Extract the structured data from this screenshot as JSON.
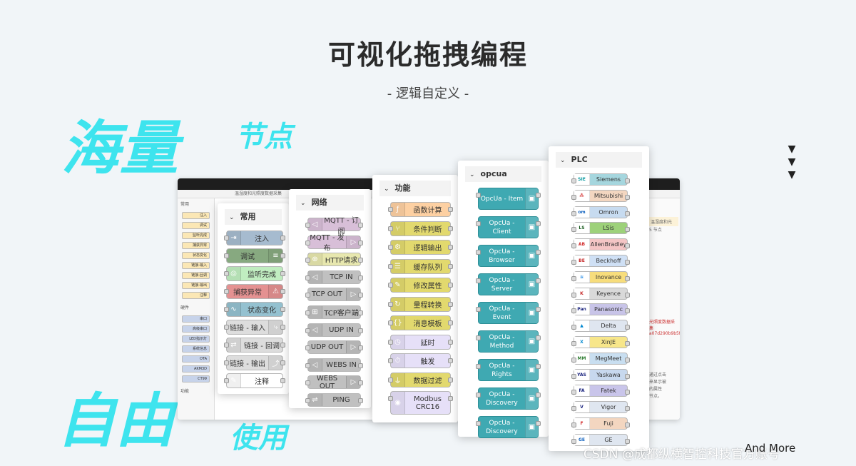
{
  "header": {
    "title": "可视化拖拽编程",
    "subtitle": "-  逻辑自定义  -"
  },
  "slogans": {
    "big1": "海量",
    "small1": "节点",
    "big2": "自由",
    "small2": "使用"
  },
  "arrows": [
    "▼",
    "▼",
    "▼"
  ],
  "window": {
    "tab": "温湿度和光照度数据采集",
    "categories": [
      "常用",
      "硬件",
      "功能"
    ],
    "mini_nodes": [
      "注入",
      "调试",
      "监听完成",
      "捕获异常",
      "状态变化",
      "链接-输入",
      "链接-回调",
      "链接-输出",
      "注释",
      "串口",
      "高级串口",
      "LED指示灯",
      "系统信息",
      "OTA",
      "AKM3D",
      "CT99"
    ],
    "right_text": [
      "温湿度和光",
      "5 节点",
      "光照度数据采集",
      "a07d290b9b5f90ca9",
      "通过点击",
      "来显示被",
      "的属性",
      "节点。"
    ]
  },
  "panels": {
    "common": {
      "title": "常用",
      "nodes": [
        {
          "label": "注入",
          "icon": "inject-icon",
          "glyph": "⇥",
          "color": "#a6bbcf"
        },
        {
          "label": "调试",
          "icon": "debug-icon",
          "glyph": "≡",
          "color": "#87a980"
        },
        {
          "label": "监听完成",
          "icon": "complete-icon",
          "glyph": "◎",
          "color": "#c0edc0"
        },
        {
          "label": "捕获异常",
          "icon": "catch-icon",
          "glyph": "⚠",
          "color": "#e49191"
        },
        {
          "label": "状态变化",
          "icon": "status-icon",
          "glyph": "∿",
          "color": "#94c1d0"
        },
        {
          "label": "链接 - 输入",
          "icon": "link-in-icon",
          "glyph": "⤷",
          "color": "#dddddd"
        },
        {
          "label": "链接 - 回调",
          "icon": "link-call-icon",
          "glyph": "⇄",
          "color": "#dddddd"
        },
        {
          "label": "链接 - 输出",
          "icon": "link-out-icon",
          "glyph": "⤴",
          "color": "#dddddd"
        },
        {
          "label": "注释",
          "icon": "comment-icon",
          "glyph": "✎",
          "color": "#ffffff"
        }
      ]
    },
    "network": {
      "title": "网络",
      "nodes": [
        {
          "label": "MQTT - 订阅",
          "icon": "mqtt-in-icon",
          "glyph": "◁",
          "color": "#d8bfd8"
        },
        {
          "label": "MQTT - 发布",
          "icon": "mqtt-out-icon",
          "glyph": "▷",
          "color": "#d8bfd8"
        },
        {
          "label": "HTTP请求",
          "icon": "http-request-icon",
          "glyph": "⊕",
          "color": "#e7e7ae"
        },
        {
          "label": "TCP IN",
          "icon": "tcp-in-icon",
          "glyph": "◁",
          "color": "#c0c0c0"
        },
        {
          "label": "TCP OUT",
          "icon": "tcp-out-icon",
          "glyph": "▷",
          "color": "#c0c0c0"
        },
        {
          "label": "TCP客户端",
          "icon": "tcp-client-icon",
          "glyph": "⊞",
          "color": "#c0c0c0"
        },
        {
          "label": "UDP IN",
          "icon": "udp-in-icon",
          "glyph": "◁",
          "color": "#c0c0c0"
        },
        {
          "label": "UDP OUT",
          "icon": "udp-out-icon",
          "glyph": "▷",
          "color": "#c0c0c0"
        },
        {
          "label": "WEBS IN",
          "icon": "websocket-in-icon",
          "glyph": "◁",
          "color": "#c0c0c0"
        },
        {
          "label": "WEBS OUT",
          "icon": "websocket-out-icon",
          "glyph": "▷",
          "color": "#c0c0c0"
        },
        {
          "label": "PING",
          "icon": "ping-icon",
          "glyph": "⇌",
          "color": "#c0c0c0"
        }
      ]
    },
    "function": {
      "title": "功能",
      "nodes": [
        {
          "label": "函数计算",
          "icon": "function-icon",
          "glyph": "ƒ",
          "color": "#fdd0a2",
          "tall": false
        },
        {
          "label": "条件判断",
          "icon": "switch-icon",
          "glyph": "⑂",
          "color": "#e2d96e",
          "tall": false
        },
        {
          "label": "逻辑输出",
          "icon": "logic-icon",
          "glyph": "⚙",
          "color": "#e2d96e",
          "tall": false
        },
        {
          "label": "缓存队列",
          "icon": "queue-icon",
          "glyph": "☰",
          "color": "#e2d96e",
          "tall": false
        },
        {
          "label": "修改属性",
          "icon": "change-icon",
          "glyph": "✎",
          "color": "#e2d96e",
          "tall": false
        },
        {
          "label": "量程转换",
          "icon": "range-icon",
          "glyph": "↻",
          "color": "#e2d96e",
          "tall": false
        },
        {
          "label": "消息模板",
          "icon": "template-icon",
          "glyph": "{}",
          "color": "#e2d96e",
          "tall": false
        },
        {
          "label": "延时",
          "icon": "delay-icon",
          "glyph": "◷",
          "color": "#e6e0f8",
          "tall": false
        },
        {
          "label": "触发",
          "icon": "trigger-icon",
          "glyph": "⏱",
          "color": "#e6e0f8",
          "tall": false
        },
        {
          "label": "数据过滤",
          "icon": "filter-icon",
          "glyph": "⏚",
          "color": "#e2d96e",
          "tall": false
        },
        {
          "label": "Modbus\nCRC16",
          "icon": "modbus-icon",
          "glyph": "◉",
          "color": "#e6e0f8",
          "tall": true
        }
      ]
    },
    "opcua": {
      "title": "opcua",
      "nodes": [
        {
          "label": "OpcUa - Item",
          "icon": "opcua-item-icon"
        },
        {
          "label": "OpcUa -\nClient",
          "icon": "opcua-client-icon"
        },
        {
          "label": "OpcUa -\nBrowser",
          "icon": "opcua-browser-icon"
        },
        {
          "label": "OpcUa -\nServer",
          "icon": "opcua-server-icon"
        },
        {
          "label": "OpcUa -\nEvent",
          "icon": "opcua-event-icon"
        },
        {
          "label": "OpcUa -\nMethod",
          "icon": "opcua-method-icon"
        },
        {
          "label": "OpcUa -\nRights",
          "icon": "opcua-rights-icon"
        },
        {
          "label": "OpcUa -\nDiscovery",
          "icon": "opcua-discovery-icon"
        },
        {
          "label": "OpcUa -\nDiscovery",
          "icon": "opcua-discovery-icon"
        }
      ]
    },
    "plc": {
      "title": "PLC",
      "nodes": [
        {
          "label": "Siemens",
          "logo": "SIE",
          "logo_color": "#0a9aa0",
          "color": "#a5d6de"
        },
        {
          "label": "Mitsubishi",
          "logo": "⁂",
          "logo_color": "#d32f2f",
          "color": "#f3d6c0"
        },
        {
          "label": "Omron",
          "logo": "om",
          "logo_color": "#1565c0",
          "color": "#c7dbf0"
        },
        {
          "label": "LSis",
          "logo": "LS",
          "logo_color": "#1b5e20",
          "color": "#9dd17a"
        },
        {
          "label": "AllenBradley",
          "logo": "AB",
          "logo_color": "#d32f2f",
          "color": "#f4c5c5"
        },
        {
          "label": "Beckhoff",
          "logo": "BE",
          "logo_color": "#c62828",
          "color": "#cfe0f5"
        },
        {
          "label": "Inovance",
          "logo": "≋",
          "logo_color": "#1e88e5",
          "color": "#f7dd7c"
        },
        {
          "label": "Keyence",
          "logo": "K",
          "logo_color": "#c62828",
          "color": "#d9d9d9"
        },
        {
          "label": "Panasonic",
          "logo": "Pan",
          "logo_color": "#1a237e",
          "color": "#c8c4e8"
        },
        {
          "label": "Delta",
          "logo": "▲",
          "logo_color": "#0288d1",
          "color": "#dfe6f0"
        },
        {
          "label": "XinJE",
          "logo": "X",
          "logo_color": "#0288d1",
          "color": "#f7e68a"
        },
        {
          "label": "MegMeet",
          "logo": "MM",
          "logo_color": "#2e7d32",
          "color": "#c8def0"
        },
        {
          "label": "Yaskawa",
          "logo": "YAS",
          "logo_color": "#1a237e",
          "color": "#c7d8ee"
        },
        {
          "label": "Fatek",
          "logo": "FA",
          "logo_color": "#1a237e",
          "color": "#c9c5ea"
        },
        {
          "label": "Vigor",
          "logo": "V",
          "logo_color": "#1a237e",
          "color": "#dfe6f0"
        },
        {
          "label": "Fuji",
          "logo": "F",
          "logo_color": "#d32f2f",
          "color": "#f3d6c0"
        },
        {
          "label": "GE",
          "logo": "GE",
          "logo_color": "#1565c0",
          "color": "#dfe6f0"
        }
      ]
    }
  },
  "watermark": "CSDN @成都纵横智控科技官方账号",
  "and_more": "And More"
}
